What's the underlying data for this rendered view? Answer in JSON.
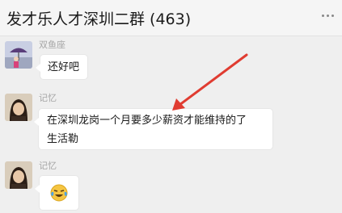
{
  "header": {
    "title": "发才乐人才深圳二群 (463)"
  },
  "messages": [
    {
      "sender": "双鱼座",
      "text": "还好吧",
      "avatar": "pisces-avatar"
    },
    {
      "sender": "记忆",
      "line1": "在深圳龙岗一个月要多少薪资才能维持的了",
      "line2": "生活勒",
      "avatar": "memory-avatar"
    },
    {
      "sender": "记忆",
      "emoji": "crying-laughing-emoji",
      "avatar": "memory-avatar"
    }
  ],
  "annotation": {
    "color": "#e03c31",
    "icon": "red-arrow-annotation"
  }
}
